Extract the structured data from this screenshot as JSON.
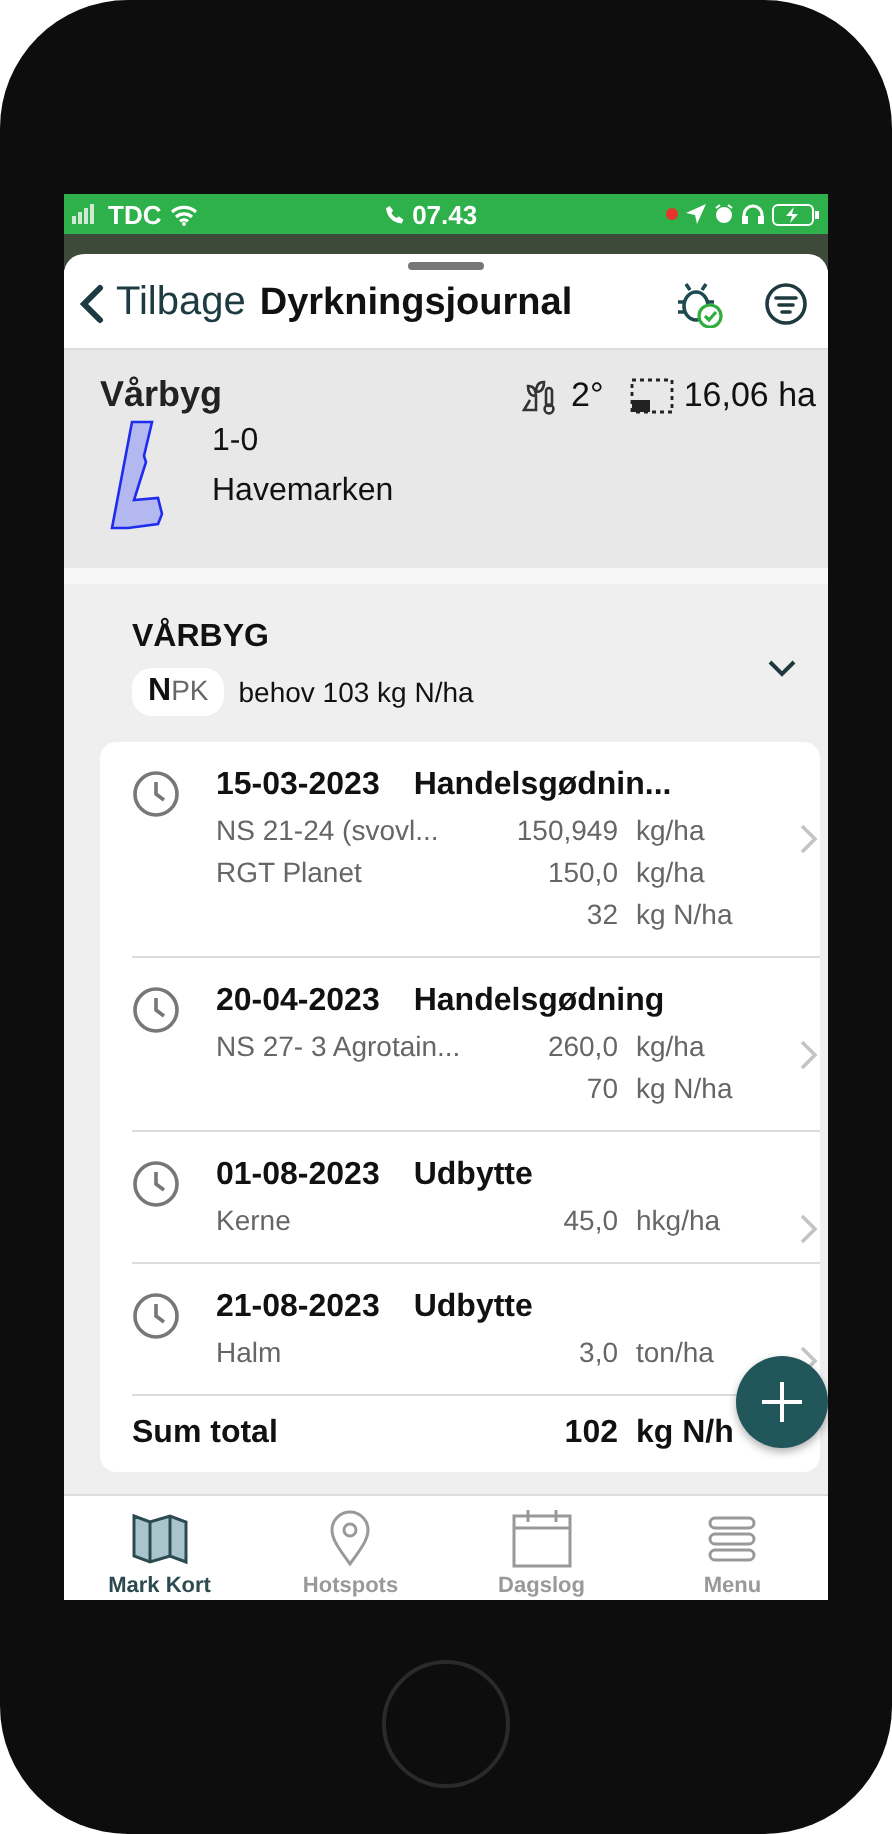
{
  "status_bar": {
    "carrier": "TDC",
    "time": "07.43"
  },
  "header": {
    "back": "Tilbage",
    "title": "Dyrkningsjournal"
  },
  "field": {
    "name": "Vårbyg",
    "temperature": "2°",
    "area": "16,06 ha",
    "number": "1-0",
    "location": "Havemarken"
  },
  "crop": {
    "title": "VÅRBYG",
    "npk": "**N**PK",
    "need": "behov 103 kg N/ha",
    "expanded": true,
    "entries": [
      {
        "date": "15-03-2023",
        "type": "Handelsgødnin...",
        "lines": [
          {
            "name": "NS 21-24 (svovl...",
            "amount": "150,949",
            "unit": "kg/ha"
          },
          {
            "name": "RGT Planet",
            "amount": "150,0",
            "unit": "kg/ha"
          }
        ],
        "n_total": {
          "amount": "32",
          "unit": "kg N/ha"
        }
      },
      {
        "date": "20-04-2023",
        "type": "Handelsgødning",
        "lines": [
          {
            "name": "NS 27- 3 Agrotain...",
            "amount": "260,0",
            "unit": "kg/ha"
          }
        ],
        "n_total": {
          "amount": "70",
          "unit": "kg N/ha"
        }
      },
      {
        "date": "01-08-2023",
        "type": "Udbytte",
        "lines": [
          {
            "name": "Kerne",
            "amount": "45,0",
            "unit": "hkg/ha"
          }
        ]
      },
      {
        "date": "21-08-2023",
        "type": "Udbytte",
        "lines": [
          {
            "name": "Halm",
            "amount": "3,0",
            "unit": "ton/ha"
          }
        ]
      }
    ],
    "sum": {
      "label": "Sum total",
      "amount": "102",
      "unit": "kg N/h"
    }
  },
  "tabs": [
    {
      "label": "Mark Kort",
      "selected": true,
      "kind": "map"
    },
    {
      "label": "Hotspots",
      "selected": false,
      "kind": "pin"
    },
    {
      "label": "Dagslog",
      "selected": false,
      "kind": "calendar"
    },
    {
      "label": "Menu",
      "selected": false,
      "kind": "menu"
    }
  ]
}
